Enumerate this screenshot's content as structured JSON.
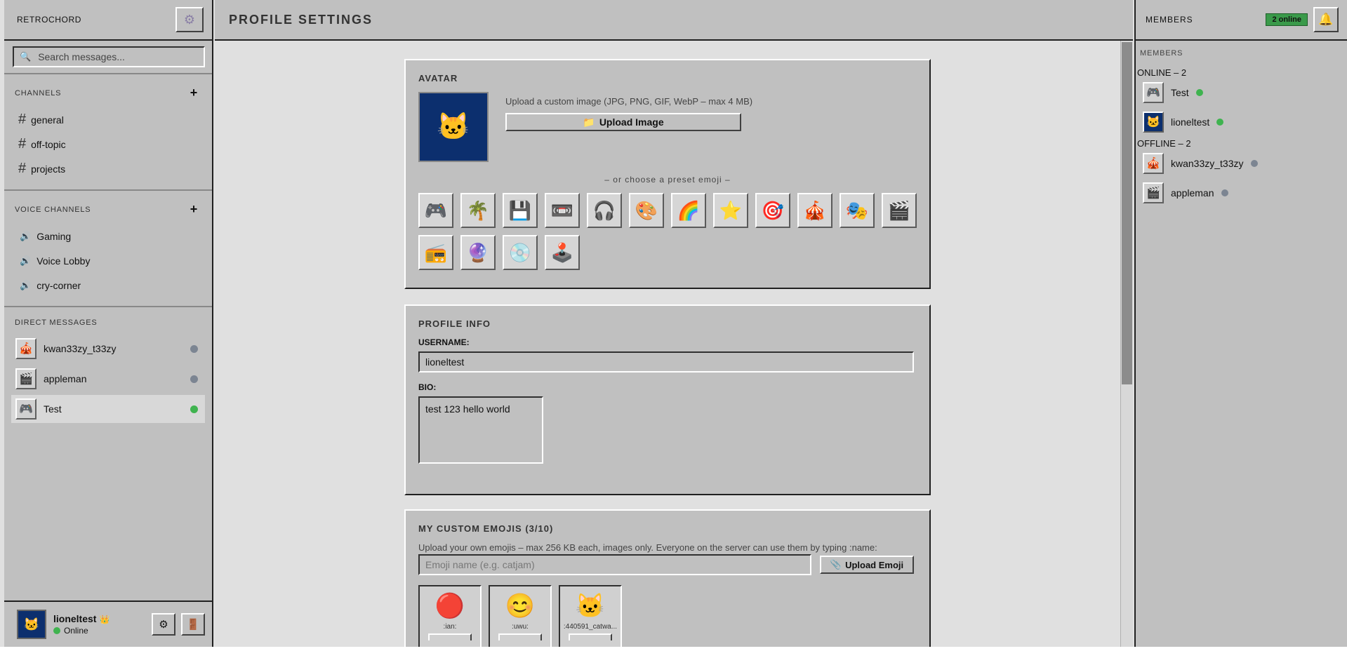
{
  "app": {
    "name": "RETROCHORD",
    "page_title": "PROFILE SETTINGS"
  },
  "left": {
    "search_placeholder": "Search messages...",
    "channels_title": "CHANNELS",
    "channels": [
      {
        "name": "general"
      },
      {
        "name": "off-topic"
      },
      {
        "name": "projects"
      }
    ],
    "voice_title": "VOICE CHANNELS",
    "voice": [
      {
        "name": "Gaming"
      },
      {
        "name": "Voice Lobby"
      },
      {
        "name": "cry-corner"
      }
    ],
    "dm_title": "DIRECT MESSAGES",
    "dms": [
      {
        "name": "kwan33zy_t33zy",
        "icon": "🎪",
        "status": "offline"
      },
      {
        "name": "appleman",
        "icon": "🎬",
        "status": "offline"
      },
      {
        "name": "Test",
        "icon": "🎮",
        "status": "online"
      }
    ],
    "user": {
      "name": "lioneltest",
      "status": "Online"
    }
  },
  "avatar": {
    "title": "AVATAR",
    "hint": "Upload a custom image (JPG, PNG, GIF, WebP – max 4 MB)",
    "upload_label": "Upload Image",
    "or_text": "– or choose a preset emoji –",
    "presets": [
      "🎮",
      "🌴",
      "💾",
      "📼",
      "🎧",
      "🎨",
      "🌈",
      "⭐",
      "🎯",
      "🎪",
      "🎭",
      "🎬",
      "📻",
      "🔮",
      "💿",
      "🕹️"
    ]
  },
  "profile": {
    "title": "PROFILE INFO",
    "username_label": "USERNAME:",
    "username_value": "lioneltest",
    "bio_label": "BIO:",
    "bio_value": "test 123 hello world"
  },
  "emojis": {
    "title": "MY CUSTOM EMOJIS (3/10)",
    "desc": "Upload your own emojis – max 256 KB each, images only. Everyone on the server can use them by typing :name:",
    "name_placeholder": "Emoji name (e.g. catjam)",
    "upload_label": "Upload Emoji",
    "items": [
      {
        "name": ":ian:",
        "icon": "🔴"
      },
      {
        "name": ":uwu:",
        "icon": "😊"
      },
      {
        "name": ":440591_catwa...",
        "icon": "🐱"
      }
    ]
  },
  "right": {
    "title": "MEMBERS",
    "online_badge": "2 online",
    "sub_title": "MEMBERS",
    "online_group": "ONLINE – 2",
    "offline_group": "OFFLINE – 2",
    "online": [
      {
        "name": "Test",
        "icon": "🎮"
      },
      {
        "name": "lioneltest",
        "icon": "🐱"
      }
    ],
    "offline": [
      {
        "name": "kwan33zy_t33zy",
        "icon": "🎪"
      },
      {
        "name": "appleman",
        "icon": "🎬"
      }
    ]
  },
  "colors": {
    "online": "#3fb34f",
    "offline": "#7c8592",
    "chrome": "#c0c0c0",
    "background": "#e0e0e0"
  }
}
